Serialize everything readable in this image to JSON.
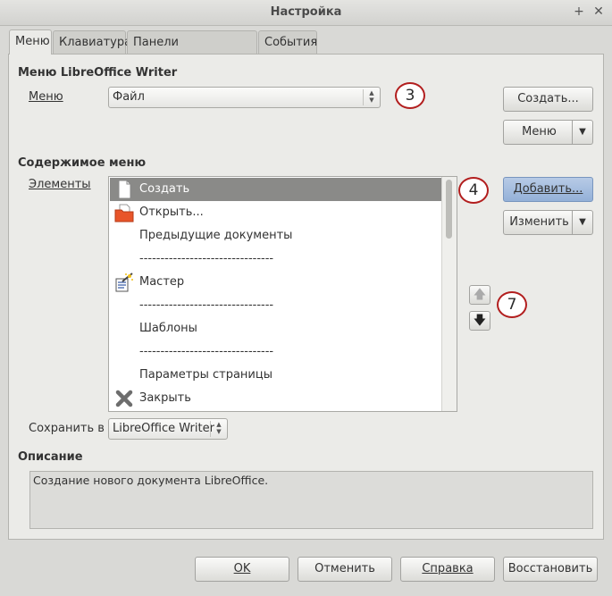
{
  "window": {
    "title": "Настройка",
    "pin_glyph": "+",
    "close_glyph": "✕"
  },
  "tabs": [
    {
      "label": "Меню",
      "active": true
    },
    {
      "label": "Клавиатура",
      "active": false
    },
    {
      "label": "Панели инструментов",
      "active": false
    },
    {
      "label": "События",
      "active": false
    }
  ],
  "menu_section": {
    "heading": "Меню LibreOffice Writer",
    "menu_label": "Меню",
    "menu_value": "Файл",
    "create_button": "Создать...",
    "menu_button": "Меню"
  },
  "content_section": {
    "heading": "Содержимое меню",
    "items_label": "Элементы",
    "items": [
      {
        "label": "Создать",
        "icon": "document-icon",
        "selected": true
      },
      {
        "label": "Открыть...",
        "icon": "folder-open-icon",
        "selected": false
      },
      {
        "label": "Предыдущие документы",
        "icon": "",
        "selected": false
      },
      {
        "label": "--------------------------------",
        "icon": "",
        "selected": false
      },
      {
        "label": "Мастер",
        "icon": "wizard-icon",
        "selected": false
      },
      {
        "label": "--------------------------------",
        "icon": "",
        "selected": false
      },
      {
        "label": "Шаблоны",
        "icon": "",
        "selected": false
      },
      {
        "label": "--------------------------------",
        "icon": "",
        "selected": false
      },
      {
        "label": "Параметры страницы",
        "icon": "",
        "selected": false
      },
      {
        "label": "Закрыть",
        "icon": "close-x-icon",
        "selected": false
      }
    ],
    "add_button": "Добавить...",
    "modify_button": "Изменить",
    "save_in_label": "Сохранить в",
    "save_in_value": "LibreOffice Writer"
  },
  "description": {
    "heading": "Описание",
    "text": "Создание нового документа LibreOffice."
  },
  "callouts": [
    "3",
    "4",
    "7"
  ],
  "footer": {
    "ok": "OK",
    "cancel": "Отменить",
    "help": "Справка",
    "reset": "Восстановить"
  },
  "colors": {
    "selection": "#8a8a88",
    "callout_border": "#b21e1e",
    "highlight_button": "#a6bfe0"
  }
}
